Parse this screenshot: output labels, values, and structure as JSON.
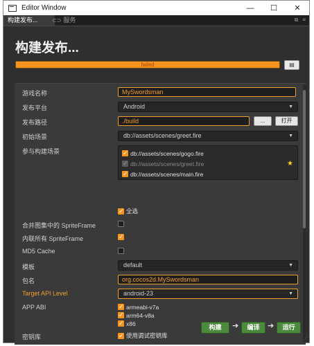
{
  "window": {
    "title": "Editor Window",
    "controls": {
      "minimize": "—",
      "maximize": "☐",
      "close": "✕"
    }
  },
  "tabs": [
    {
      "label": "构建发布...",
      "active": true
    },
    {
      "label": "服务",
      "active": false,
      "icon": "link-icon"
    }
  ],
  "page": {
    "title": "构建发布...",
    "progress": {
      "status": "failed",
      "percent": 100,
      "color": "#f6941e"
    },
    "log_button": "▤"
  },
  "form": {
    "game_name": {
      "label": "游戏名称",
      "value": "MySwordsman"
    },
    "platform": {
      "label": "发布平台",
      "value": "Android"
    },
    "build_path": {
      "label": "发布路径",
      "value": "./build",
      "browse": "...",
      "open": "打开"
    },
    "start_scene": {
      "label": "初始场景",
      "value": "db://assets/scenes/greet.fire"
    },
    "scenes": {
      "label": "参与构建场景",
      "items": [
        {
          "path": "db://assets/scenes/gogo.fire",
          "checked": true,
          "disabled": false
        },
        {
          "path": "db://assets/scenes/greet.fire",
          "checked": true,
          "disabled": true
        },
        {
          "path": "db://assets/scenes/main.fire",
          "checked": true,
          "disabled": false
        }
      ],
      "select_all": "全选"
    },
    "merge_spriteframe": {
      "label": "合并图集中的 SpriteFrame",
      "checked": false
    },
    "inline_spriteframe": {
      "label": "内联所有 SpriteFrame",
      "checked": true
    },
    "md5_cache": {
      "label": "MD5 Cache",
      "checked": false
    },
    "template": {
      "label": "模板",
      "value": "default"
    },
    "package_name": {
      "label": "包名",
      "value": "org.cocos2d.MySwordsman"
    },
    "target_api": {
      "label": "Target API Level",
      "value": "android-23"
    },
    "app_abi": {
      "label": "APP ABI",
      "items": [
        {
          "name": "armeabi-v7a",
          "checked": true
        },
        {
          "name": "arm64-v8a",
          "checked": true
        },
        {
          "name": "x86",
          "checked": true
        }
      ]
    },
    "keystore": {
      "label": "密钥库",
      "option": "使用调试密钥库",
      "checked": true
    }
  },
  "actions": {
    "build": "构建",
    "compile": "编译",
    "run": "运行"
  },
  "colors": {
    "accent": "#f39c2f",
    "progress": "#f6941e",
    "button_green": "#4b8a3c"
  }
}
